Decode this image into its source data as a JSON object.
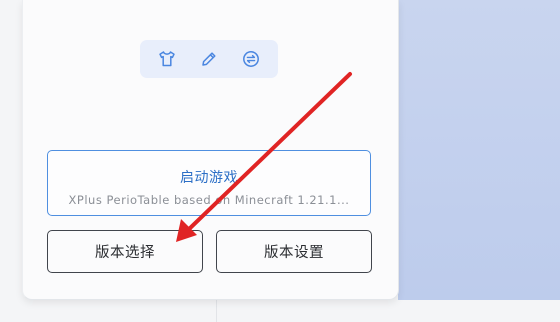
{
  "toolbar": {
    "icons": [
      "shirt-icon",
      "pencil-icon",
      "swap-icon"
    ],
    "icon_color": "#4a86e0",
    "background": "#e8eefb"
  },
  "launch": {
    "title": "启动游戏",
    "subtitle": "XPlus PerioTable based on Minecraft 1.21.1...",
    "accent": "#4f8fe0"
  },
  "buttons": {
    "version_select": "版本选择",
    "version_settings": "版本设置"
  },
  "annotation": {
    "arrow_color": "#e02424"
  }
}
